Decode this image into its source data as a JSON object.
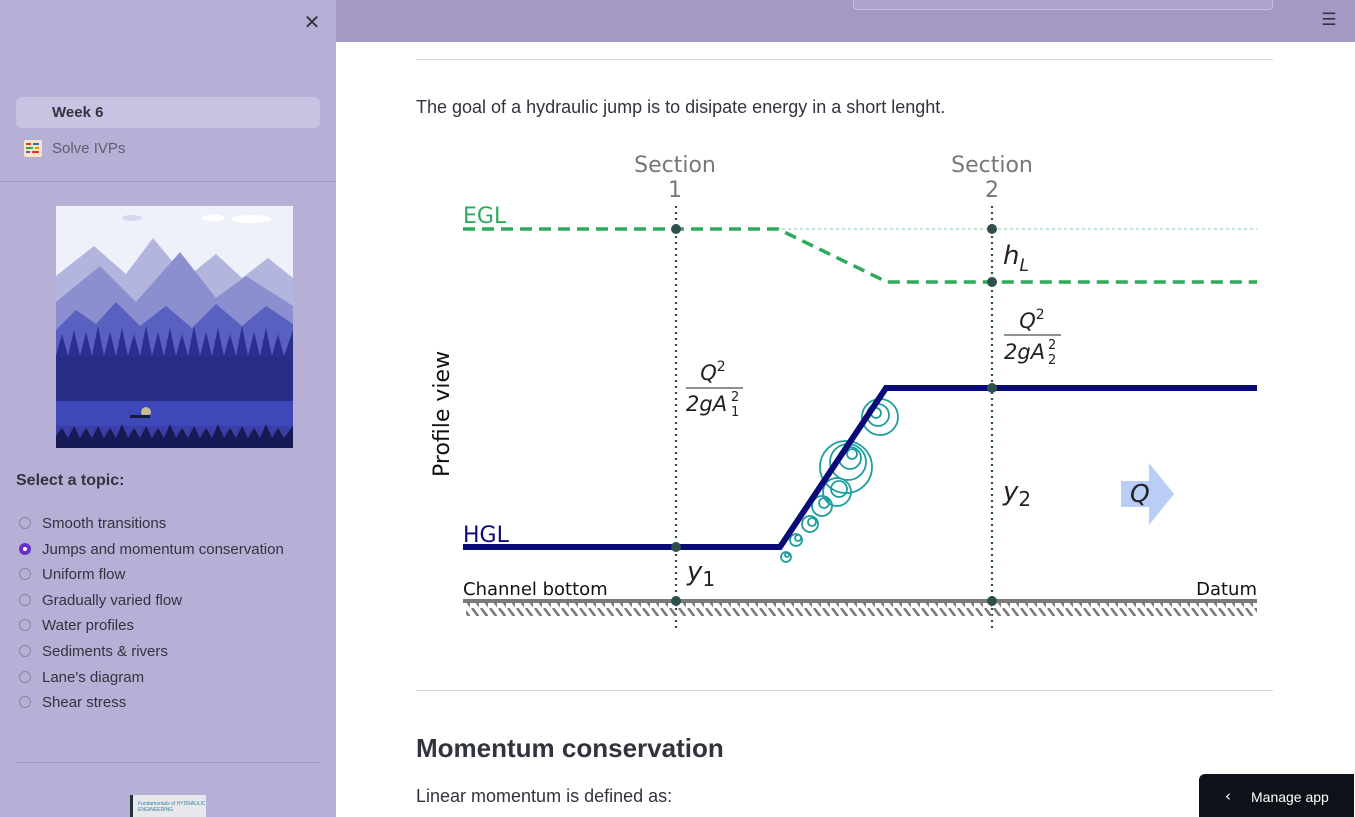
{
  "sidebar": {
    "close_icon": "close-icon",
    "nav": {
      "week": "Week 6",
      "items": [
        {
          "label": "Solve IVPs",
          "icon": "notebook-icon"
        }
      ]
    },
    "topic_heading": "Select a topic:",
    "topics": [
      {
        "label": "Smooth transitions",
        "selected": false
      },
      {
        "label": "Jumps and momentum conservation",
        "selected": true
      },
      {
        "label": "Uniform flow",
        "selected": false
      },
      {
        "label": "Gradually varied flow",
        "selected": false
      },
      {
        "label": "Water profiles",
        "selected": false
      },
      {
        "label": "Sediments & rivers",
        "selected": false
      },
      {
        "label": "Lane's diagram",
        "selected": false
      },
      {
        "label": "Shear stress",
        "selected": false
      }
    ],
    "book_thumbnail_text": "Fundamentals of HYDRAULIC ENGINEERING"
  },
  "header": {
    "menu_icon": "hamburger-menu-icon"
  },
  "main": {
    "intro": "The goal of a hydraulic jump is to disipate energy in a short lenght.",
    "diagram": {
      "section1": [
        "Section",
        "1"
      ],
      "section2": [
        "Section",
        "2"
      ],
      "egl": "EGL",
      "hgl": "HGL",
      "profile_view": "Profile view",
      "channel_bottom": "Channel bottom",
      "datum": "Datum",
      "hl": "h",
      "hl_sub": "L",
      "y1": "y",
      "y1_sub": "1",
      "y2": "y",
      "y2_sub": "2",
      "q": "Q",
      "vh_num": "Q",
      "vh_exp": "2",
      "vh_den": "2gA",
      "vh1_sub": "1",
      "vh2_sub": "2",
      "colors": {
        "egl": "#2eaa5c",
        "hgl": "#0a0a78",
        "marker": "#2f4f4f",
        "flow_arrow": "#b9cdf7",
        "turbulence": "#1e9e9e"
      }
    },
    "heading": "Momentum conservation",
    "paragraph": "Linear momentum is defined as:"
  },
  "manage_app": {
    "label": "Manage app",
    "icon": "chevron-left-icon"
  }
}
